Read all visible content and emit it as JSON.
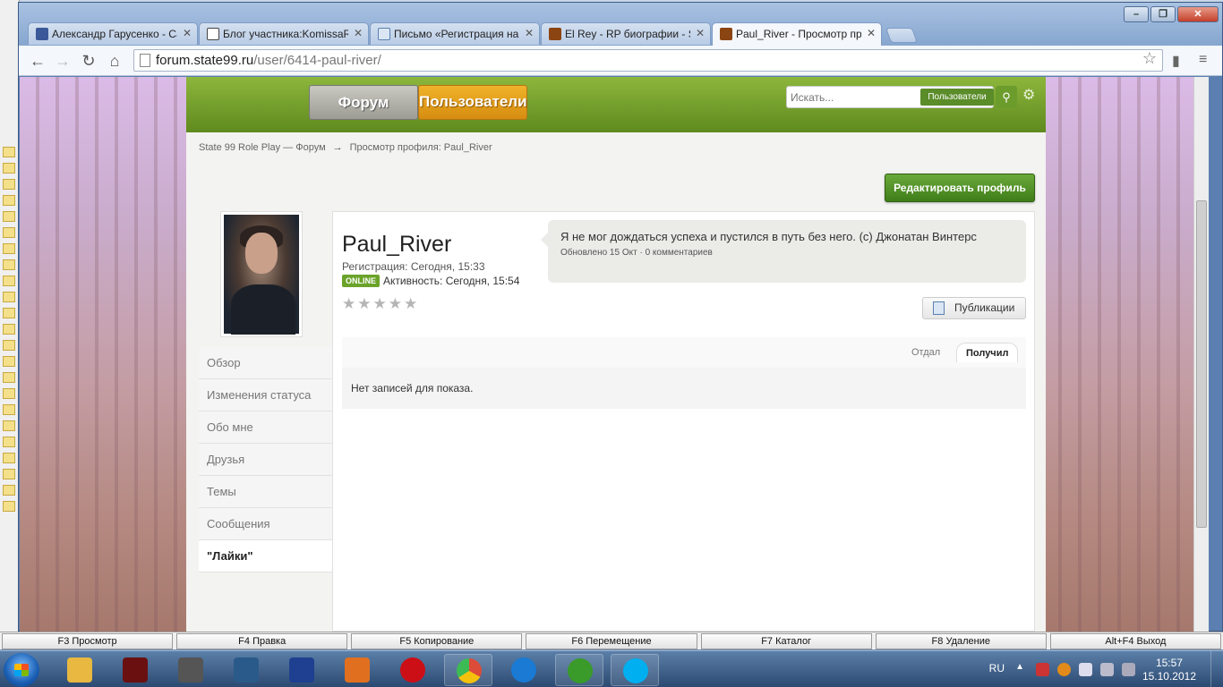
{
  "browser": {
    "tabs": [
      {
        "label": "Александр Гарусенко - Са",
        "favicon_color": "#3b5998",
        "favicon": "facebook-icon"
      },
      {
        "label": "Блог участника:KomissaR",
        "favicon_color": "#444444",
        "favicon": "puzzle-icon"
      },
      {
        "label": "Письмо «Регистрация на",
        "favicon_color": "#5a7fb0",
        "favicon": "mail-icon"
      },
      {
        "label": "El Rey - RP биографии - St",
        "favicon_color": "#8b4513",
        "favicon": "forum-icon"
      },
      {
        "label": "Paul_River - Просмотр про",
        "favicon_color": "#8b4513",
        "favicon": "forum-icon",
        "active": true
      }
    ],
    "url_domain": "forum.state99.ru",
    "url_path": "/user/6414-paul-river/"
  },
  "site": {
    "nav": {
      "forum": "Форум",
      "users": "Пользователи"
    },
    "search": {
      "placeholder": "Искать...",
      "scope": "Пользователи"
    },
    "breadcrumb": {
      "root": "State 99 Role Play — Форум",
      "arrow": "→",
      "current": "Просмотр профиля: Paul_River"
    },
    "edit_profile": "Редактировать профиль"
  },
  "profile": {
    "username": "Paul_River",
    "registration": "Регистрация: Сегодня, 15:33",
    "online_badge": "ONLINE",
    "activity": "Активность: Сегодня, 15:54",
    "rating_stars": 5,
    "status_text": "Я не мог дождаться успеха и пустился в путь без него. (с) Джонатан Винтерс",
    "status_meta": "Обновлено 15 Окт · 0 комментариев",
    "publications": "Публикации",
    "likes_tabs": {
      "sent": "Отдал",
      "received": "Получил"
    },
    "no_records": "Нет записей для показа."
  },
  "side_menu": [
    {
      "label": "Обзор"
    },
    {
      "label": "Изменения статуса"
    },
    {
      "label": "Обо мне"
    },
    {
      "label": "Друзья"
    },
    {
      "label": "Темы"
    },
    {
      "label": "Сообщения"
    },
    {
      "label": "\"Лайки\"",
      "active": true
    }
  ],
  "fkeys": [
    "F3 Просмотр",
    "F4 Правка",
    "F5 Копирование",
    "F6 Перемещение",
    "F7 Каталог",
    "F8 Удаление",
    "Alt+F4 Выход"
  ],
  "taskbar": {
    "apps": [
      {
        "name": "explorer-icon",
        "color": "#e8b840"
      },
      {
        "name": "mafia-icon",
        "color": "#6b1010"
      },
      {
        "name": "assassins-creed-icon",
        "color": "#555555"
      },
      {
        "name": "kmplayer-icon",
        "color": "#2a5a8a"
      },
      {
        "name": "floppy-save-icon",
        "color": "#1f3f90"
      },
      {
        "name": "media-player-icon",
        "color": "#e07020"
      },
      {
        "name": "opera-icon",
        "color": "#cc0f16"
      },
      {
        "name": "chrome-icon",
        "color": "#dd4b39",
        "active": true
      },
      {
        "name": "lightning-icon",
        "color": "#1a7ad4"
      },
      {
        "name": "utorrent-icon",
        "color": "#3a9a2a"
      },
      {
        "name": "skype-icon",
        "color": "#00aff0"
      }
    ],
    "lang": "RU",
    "time": "15:57",
    "date": "15.10.2012"
  }
}
